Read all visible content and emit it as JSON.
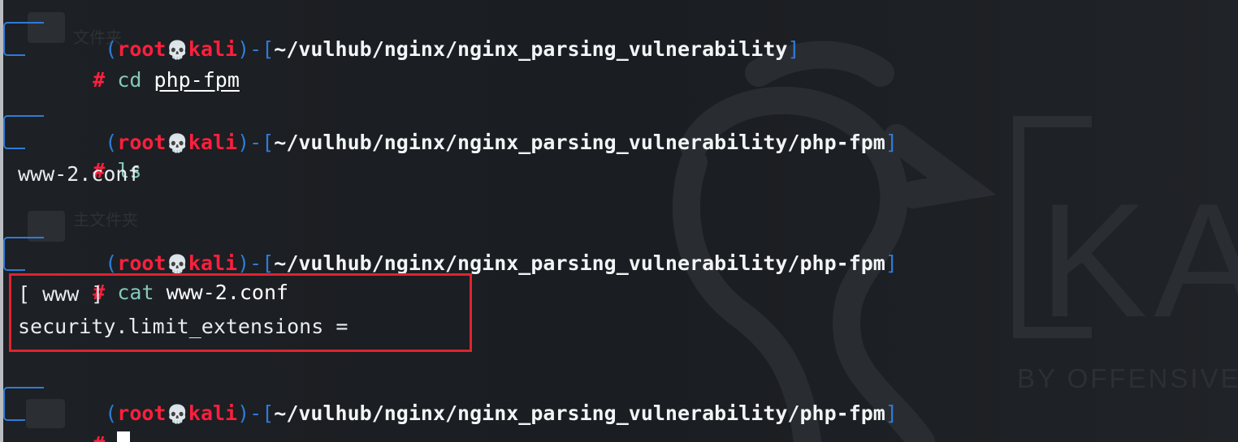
{
  "terminal": {
    "prompts": [
      {
        "open": "(",
        "user": "root",
        "skull": "💀",
        "host": "kali",
        "close_open": ")-[",
        "path": "~/vulhub/nginx/nginx_parsing_vulnerability",
        "close": "]",
        "hash": "#",
        "command": "cd",
        "argument": "php-fpm"
      },
      {
        "open": "(",
        "user": "root",
        "skull": "💀",
        "host": "kali",
        "close_open": ")-[",
        "path": "~/vulhub/nginx/nginx_parsing_vulnerability/php-fpm",
        "close": "]",
        "hash": "#",
        "command": "ls",
        "argument": ""
      },
      {
        "open": "(",
        "user": "root",
        "skull": "💀",
        "host": "kali",
        "close_open": ")-[",
        "path": "~/vulhub/nginx/nginx_parsing_vulnerability/php-fpm",
        "close": "]",
        "hash": "#",
        "command": "cat",
        "argument": "www-2.conf"
      },
      {
        "open": "(",
        "user": "root",
        "skull": "💀",
        "host": "kali",
        "close_open": ")-[",
        "path": "~/vulhub/nginx/nginx_parsing_vulnerability/php-fpm",
        "close": "]",
        "hash": "#",
        "command": "",
        "argument": ""
      }
    ],
    "outputs": {
      "ls": "www-2.conf",
      "cat_line_1": "[ www ]",
      "cat_line_2": "security.limit_extensions ="
    }
  },
  "wallpaper": {
    "logo_text": "KA",
    "tagline": "BY OFFENSIVE",
    "faint_label_1": "文件夹",
    "faint_label_2": "主文件夹"
  },
  "colors": {
    "background": "#1a1d21",
    "prompt_red": "#ff1f3d",
    "prompt_blue": "#2f7bd8",
    "command_teal": "#83c8bd",
    "highlight_red": "#e0232e"
  }
}
